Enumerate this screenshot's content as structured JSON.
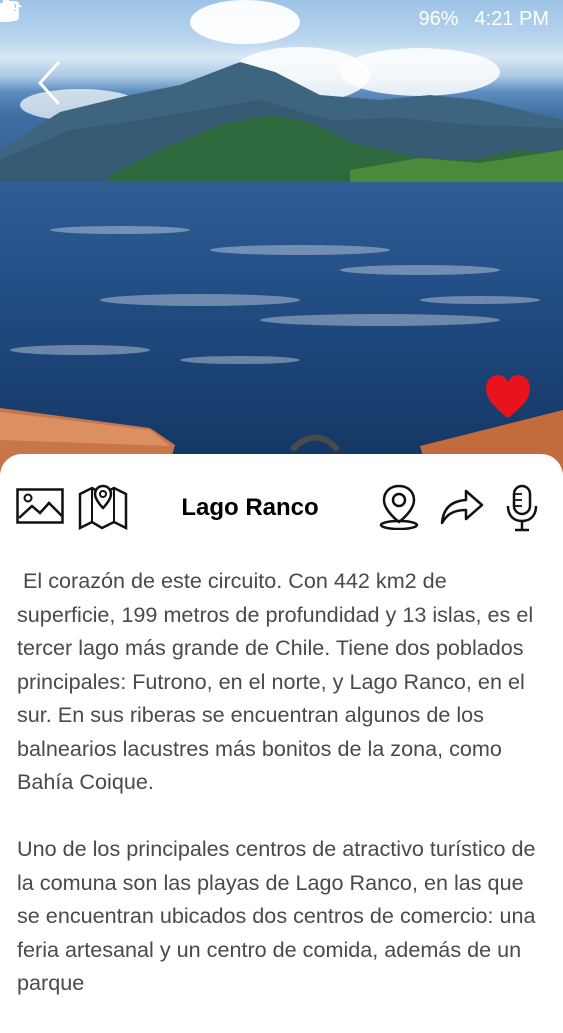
{
  "status_bar": {
    "battery": "96%",
    "time": "4:21 PM",
    "icons": [
      "screenshot-icon",
      "location-icon",
      "wifi-icon",
      "signal-icon",
      "battery-icon"
    ]
  },
  "header": {
    "back_icon": "back-arrow-icon",
    "favorite_icon": "heart-icon",
    "favorite_color": "#e8131b"
  },
  "place": {
    "title": "Lago Ranco",
    "paragraphs": [
      " El corazón de este circuito. Con 442 km2 de superficie, 199 metros de profundidad y 13 islas, es el tercer lago más grande de Chile. Tiene dos poblados principales: Futrono, en el norte, y Lago Ranco, en el sur. En sus riberas se encuentran algunos de los balnearios lacustres más bonitos de la zona, como Bahía Coique.",
      "Uno de los principales centros de atractivo turístico de la comuna son las playas de Lago Ranco, en las que se encuentran ubicados dos centros de comercio: una feria artesanal y un centro de comida, además de un parque"
    ]
  },
  "toolbar": {
    "icons": [
      "gallery-icon",
      "map-icon",
      "location-pin-icon",
      "share-icon",
      "microphone-icon"
    ]
  }
}
